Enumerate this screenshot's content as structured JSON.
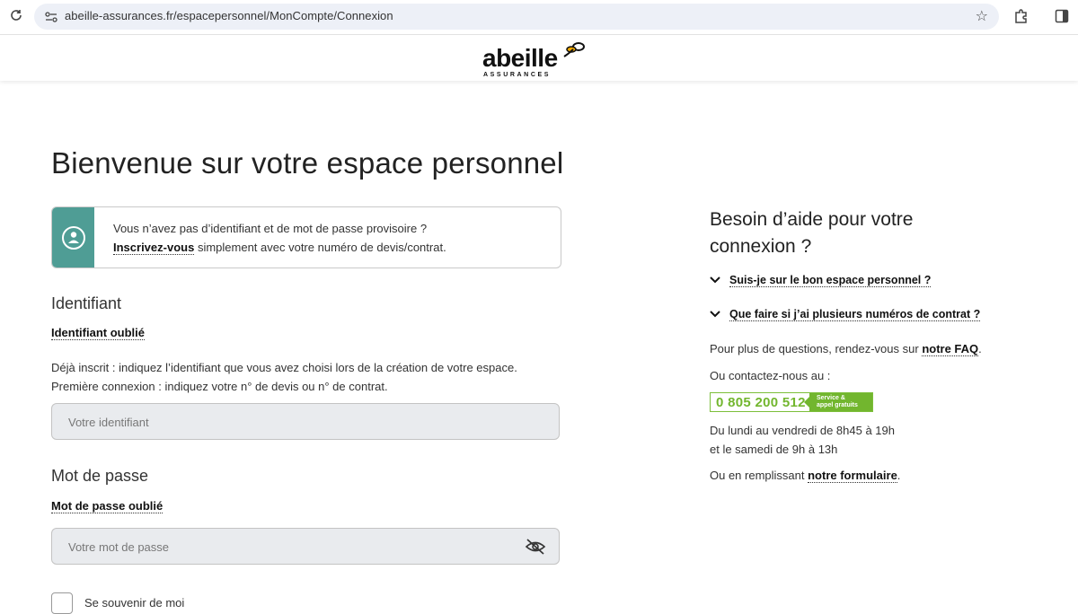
{
  "browser": {
    "url": "abeille-assurances.fr/espacepersonnel/MonCompte/Connexion"
  },
  "brand": {
    "name": "abeille",
    "subtitle": "ASSURANCES"
  },
  "page": {
    "title": "Bienvenue sur votre espace personnel"
  },
  "info_box": {
    "line1": "Vous n’avez pas d’identifiant et de mot de passe provisoire ?",
    "register_link": "Inscrivez-vous",
    "line2_rest": " simplement avec votre numéro de devis/contrat."
  },
  "identifier": {
    "title": "Identifiant",
    "forgot": "Identifiant oublié",
    "help1": "Déjà inscrit : indiquez l’identifiant que vous avez choisi lors de la création de votre espace.",
    "help2": "Première connexion : indiquez votre n° de devis ou n° de contrat.",
    "placeholder": "Votre identifiant",
    "value": ""
  },
  "password": {
    "title": "Mot de passe",
    "forgot": "Mot de passe oublié",
    "placeholder": "Votre mot de passe",
    "value": ""
  },
  "remember": {
    "label": "Se souvenir de moi"
  },
  "help": {
    "title": "Besoin d’aide pour votre connexion ?",
    "faq": [
      "Suis-je sur le bon espace personnel ?",
      "Que faire si j’ai plusieurs numéros de contrat ?"
    ],
    "questions_prefix": "Pour plus de questions, rendez-vous sur ",
    "faq_link": "notre FAQ",
    "contact_text": "Ou contactez-nous au :",
    "phone_number": "0 805 200 512",
    "phone_tag_line1": "Service &",
    "phone_tag_line2": "appel gratuits",
    "hours1": "Du lundi au vendredi de 8h45 à 19h",
    "hours2": "et le samedi de 9h à 13h",
    "form_prefix": "Ou en remplissant ",
    "form_link": "notre formulaire"
  },
  "colors": {
    "accent_teal": "#4f9d95",
    "phone_green": "#72b62e"
  }
}
